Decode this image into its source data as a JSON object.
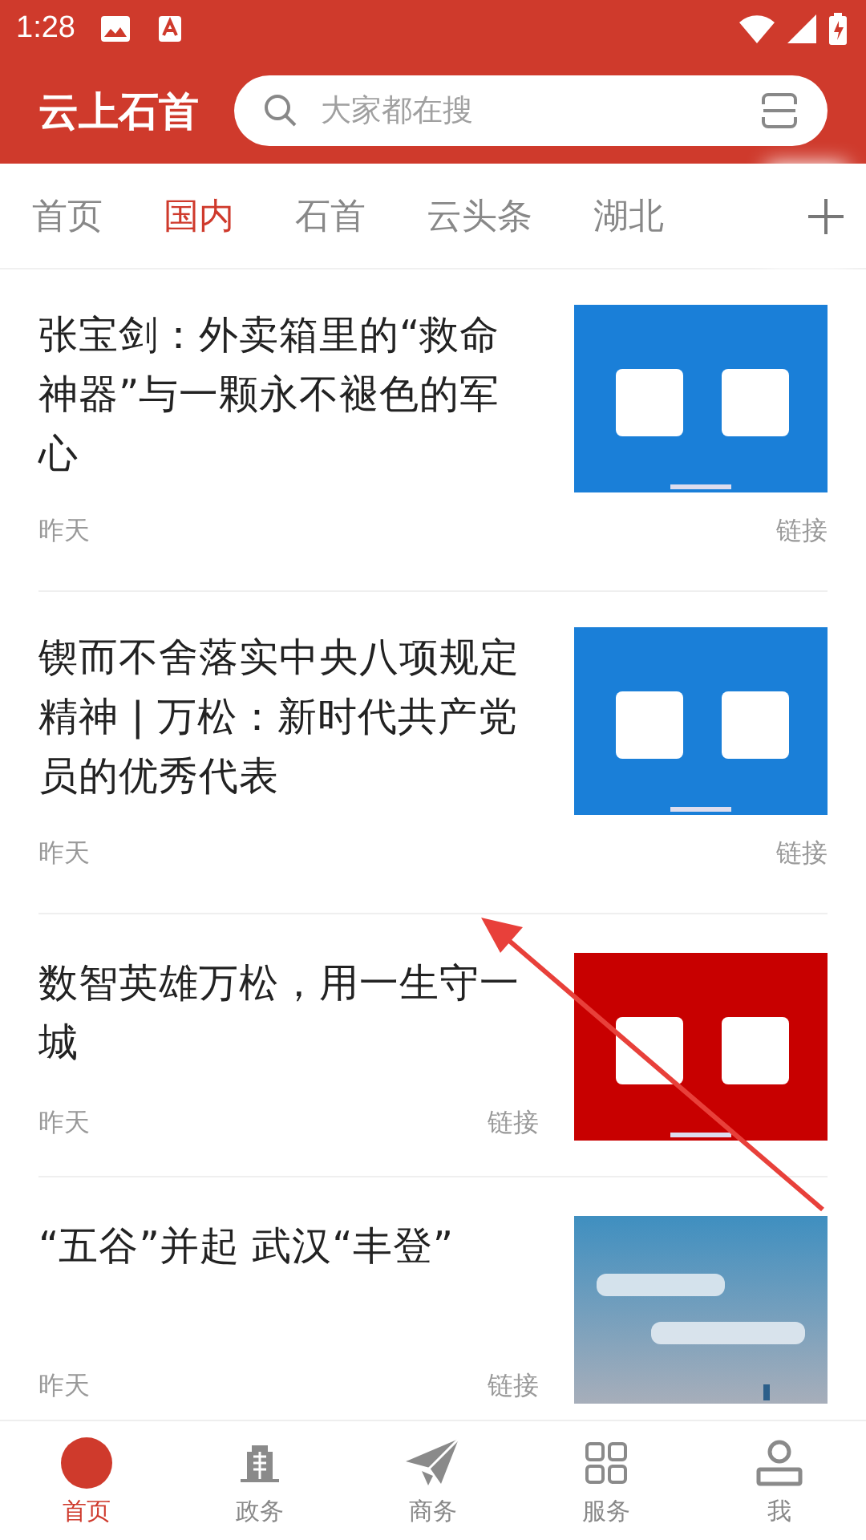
{
  "status_bar": {
    "time": "1:28"
  },
  "header": {
    "title": "云上石首",
    "search": {
      "placeholder": "大家都在搜"
    }
  },
  "tabs": [
    {
      "label": "首页",
      "selected": false
    },
    {
      "label": "国内",
      "selected": true
    },
    {
      "label": "石首",
      "selected": false
    },
    {
      "label": "云头条",
      "selected": false
    },
    {
      "label": "湖北",
      "selected": false
    }
  ],
  "articles": [
    {
      "kind": "full-meta",
      "title": "张宝剑：外卖箱里的“救命神器”与一颗永不褪色的军心",
      "date": "昨天",
      "link": "链接"
    },
    {
      "kind": "full-meta",
      "title": "锲而不舍落实中央八项规定精神 | 万松：新时代共产党员的优秀代表",
      "date": "昨天",
      "link": "链接"
    },
    {
      "kind": "side-meta",
      "title": "数智英雄万松，用一生守一城",
      "date": "昨天",
      "link": "链接"
    },
    {
      "kind": "side-meta",
      "title": "“五谷”并起 武汉“丰登”",
      "date": "昨天",
      "link": "链接"
    }
  ],
  "bottom_nav": [
    {
      "label": "首页",
      "selected": true
    },
    {
      "label": "政务",
      "selected": false
    },
    {
      "label": "商务",
      "selected": false
    },
    {
      "label": "服务",
      "selected": false
    },
    {
      "label": "我",
      "selected": false
    }
  ]
}
